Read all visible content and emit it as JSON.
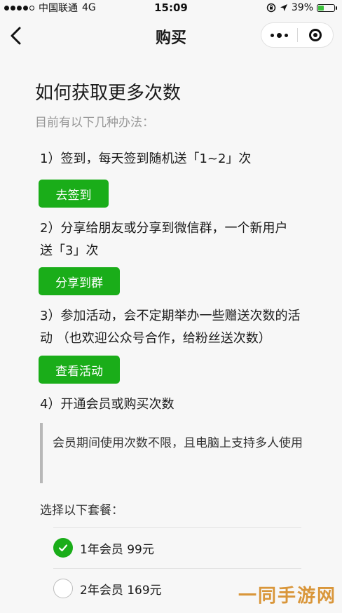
{
  "status_bar": {
    "carrier": "中国联通",
    "network": "4G",
    "time": "15:09",
    "battery": "39%",
    "battery_level": 0.39,
    "icons": [
      "signal-dots-icon",
      "lock-rotation-icon",
      "location-arrow-icon",
      "battery-icon"
    ]
  },
  "nav": {
    "title": "购买",
    "back_icon": "chevron-left-icon",
    "more_icon": "more-dots-icon",
    "close_icon": "target-close-icon"
  },
  "content": {
    "heading": "如何获取更多次数",
    "subheading": "目前有以下几种办法：",
    "steps": [
      {
        "text": "1）签到，每天签到随机送「1~2」次",
        "button": "去签到"
      },
      {
        "text": "2）分享给朋友或分享到微信群，一个新用户送「3」次",
        "button": "分享到群"
      },
      {
        "text": "3）参加活动，会不定期举办一些赠送次数的活动 （也欢迎公众号合作，给粉丝送次数）",
        "button": "查看活动"
      },
      {
        "text": "4）开通会员或购买次数"
      }
    ],
    "quote": "会员期间使用次数不限，且电脑上支持多人使用",
    "packages_label": "选择以下套餐：",
    "packages": [
      {
        "label": "1年会员 99元",
        "selected": true
      },
      {
        "label": "2年会员 169元",
        "selected": false
      }
    ]
  },
  "watermark": "一同手游网",
  "colors": {
    "accent_green": "#1aad19",
    "watermark": "#d9963a"
  }
}
